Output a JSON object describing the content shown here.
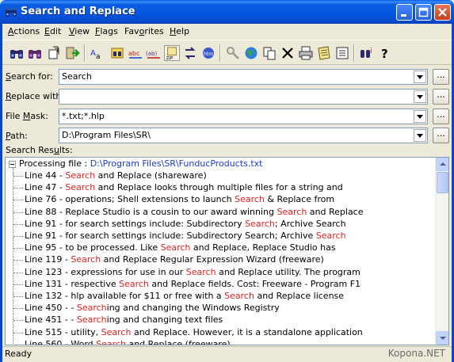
{
  "window": {
    "title": "Search and Replace"
  },
  "menu": [
    {
      "accel": "A",
      "rest": "ctions"
    },
    {
      "accel": "E",
      "rest": "dit"
    },
    {
      "accel": "V",
      "rest": "iew"
    },
    {
      "accel": "F",
      "rest": "lags"
    },
    {
      "pre": "Fav",
      "accel": "o",
      "rest": "rites"
    },
    {
      "accel": "H",
      "rest": "elp"
    }
  ],
  "toolbar": {
    "icons": [
      "binoculars-icon",
      "binoculars-replace-icon",
      "open-icon",
      "exit-icon",
      "case-icon",
      "find-in-files-icon",
      "abc-icon",
      "abc-regex-icon",
      "zip-icon",
      "replace-icon",
      "html-icon",
      "tools-icon",
      "globe-icon",
      "copy-icon",
      "delete-icon",
      "print-icon",
      "notes-icon",
      "list-icon",
      "about-icon",
      "help-icon"
    ]
  },
  "form": {
    "search_for": {
      "pre": "",
      "accel": "S",
      "rest": "earch for:",
      "value": "Search"
    },
    "replace_with": {
      "pre": "",
      "accel": "R",
      "rest": "eplace with:",
      "value": ""
    },
    "file_mask": {
      "pre": "File ",
      "accel": "M",
      "rest": "ask:",
      "value": "*.txt;*.hlp"
    },
    "path": {
      "pre": "",
      "accel": "P",
      "rest": "ath:",
      "value": "D:\\Program Files\\SR\\"
    },
    "browse_label": "..."
  },
  "results": {
    "label_pre": "Search Res",
    "label_accel": "u",
    "label_rest": "lts:",
    "header_prefix": "Processing file : ",
    "header_path": "D:\\Program Files\\SR\\FunducProducts.txt",
    "lines": [
      {
        "pre": "Line  44 - ",
        "hit": "Search",
        "post": " and Replace (shareware)"
      },
      {
        "pre": "Line  47 - ",
        "hit": "Search",
        "post": " and Replace looks through multiple files for a string and"
      },
      {
        "pre": "Line  76 - operations; Shell extensions to launch ",
        "hit": "Search",
        "post": " & Replace from"
      },
      {
        "pre": "Line  88 - Replace Studio is a cousin to our award winning ",
        "hit": "Search",
        "post": " and Replace"
      },
      {
        "pre": "Line  91 - for search settings include: Subdirectory ",
        "hit": "Search",
        "post": "; Archive Search"
      },
      {
        "pre": "Line  91 - for search settings include: Subdirectory Search; Archive ",
        "hit": "Search",
        "post": ""
      },
      {
        "pre": "Line  95 - to be processed. Like ",
        "hit": "Search",
        "post": " and Replace, Replace Studio has"
      },
      {
        "pre": "Line 119 - ",
        "hit": "Search",
        "post": " and Replace Regular Expression Wizard (freeware)"
      },
      {
        "pre": "Line 123 - expressions for use in our ",
        "hit": "Search",
        "post": " and Replace utility. The program"
      },
      {
        "pre": "Line 131 - respective ",
        "hit": "Search",
        "post": " and Replace fields. Cost: Freeware - Program F1"
      },
      {
        "pre": "Line 132 - hlp available for $11 or free with a ",
        "hit": "Search",
        "post": " and Replace license"
      },
      {
        "pre": "Line 450 - - ",
        "hit": "Search",
        "post": "ing and changing the Windows Registry"
      },
      {
        "pre": "Line 451 - - ",
        "hit": "Search",
        "post": "ing and changing text files"
      },
      {
        "pre": "Line 515 - utility, ",
        "hit": "Search",
        "post": " and Replace. However, it is a standalone application"
      },
      {
        "pre": "Line 560 - Word ",
        "hit": "Search",
        "post": " and Replace (freeware)"
      }
    ]
  },
  "status": {
    "text": "Ready",
    "watermark": "Kopona.NET"
  },
  "colors": {
    "hit": "#e01f1f",
    "path": "#1a3ccf",
    "titlebar": "#0554e0"
  }
}
